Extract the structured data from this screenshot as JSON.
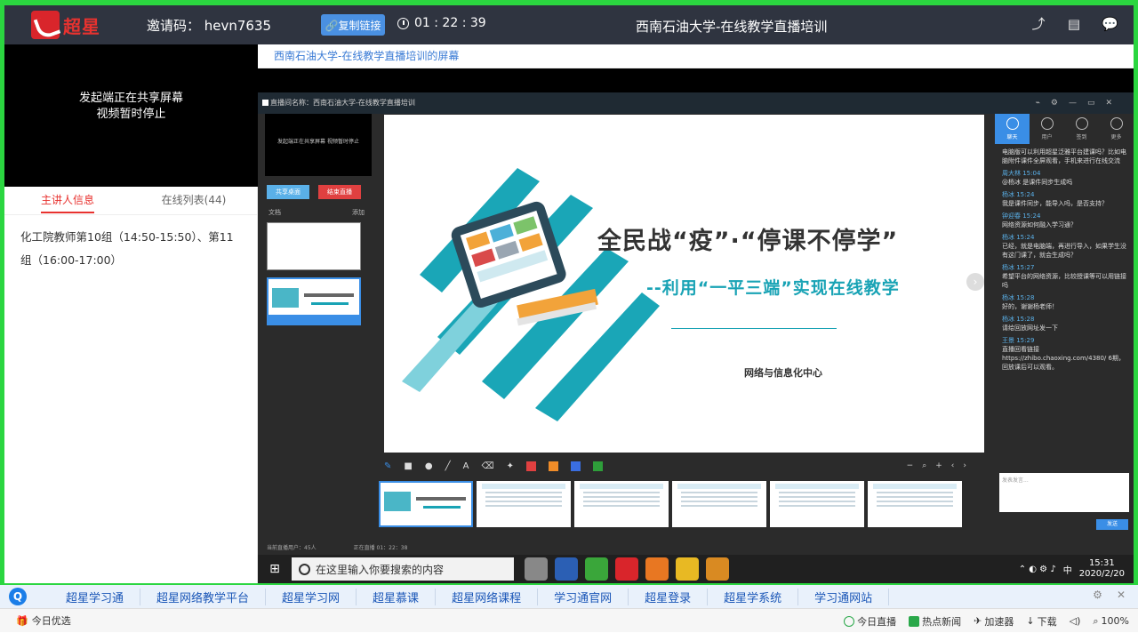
{
  "topbar": {
    "logo_text": "超星",
    "invite": "邀请码： hevn7635",
    "copy_label": "🔗复制链接",
    "timer": "01 : 22 : 39",
    "title": "西南石油大学-在线教学直播培训"
  },
  "left": {
    "video_line1": "发起端正在共享屏幕",
    "video_line2": "视频暂时停止",
    "tab_host": "主讲人信息",
    "tab_online": "在线列表(44)",
    "host_info": "化工院教师第10组（14:50-15:50）、第11组（16:00-17:00）"
  },
  "share": {
    "title": "西南石油大学-在线教学直播培训的屏幕",
    "app_title": "直播间名称：西南石油大学-在线教学直播培训",
    "mini_video": "发起端正在共享屏幕 视频暂时停止",
    "btn_blue": "共享桌面",
    "btn_red": "结束直播",
    "col_doc": "文档",
    "col_add": "添加",
    "slide_title": "全民战“疫”·“停课不停学”",
    "slide_sub": "--利用“一平三端”实现在线教学",
    "slide_org": "网络与信息化中心",
    "status": "当前直播用户：45人",
    "live_time": "正在直播 01：22：38",
    "chat_tabs": [
      "聊天",
      "用户",
      "签到",
      "更多"
    ],
    "chat": [
      {
        "who": "",
        "text": "电脑版可以利用超星泛雅平台建课吗？比如电脑附件课件全屏观看，手机来进行在线交流"
      },
      {
        "who": "周大林 15:04",
        "text": "@杨冰 是课件同步生成吗"
      },
      {
        "who": "杨冰 15:24",
        "text": "我是课件同步，能导入吗，是否支持？"
      },
      {
        "who": "钟迎春 15:24",
        "text": "网络资源如何融入学习通？"
      },
      {
        "who": "杨冰 15:24",
        "text": "已经，就是电脑端，再进行导入，如果学生没有这门课了，就会生成吗？"
      },
      {
        "who": "杨冰 15:27",
        "text": "希望平台的网络资源，比较授课等可以用链接吗"
      },
      {
        "who": "杨冰 15:28",
        "text": "好的，谢谢杨老师！"
      },
      {
        "who": "杨冰 15:28",
        "text": "请给回放网址发一下"
      },
      {
        "who": "王景 15:29",
        "text": "直播回看链接 https://zhibo.chaoxing.com/4380/ 6期，回放课后可以观看。"
      }
    ],
    "chat_placeholder": "发表发言..."
  },
  "taskbar": {
    "search": "在这里输入你要搜索的内容",
    "time": "15:31",
    "date": "2020/2/20",
    "lang": "中"
  },
  "linkbar": {
    "links": [
      "超星学习通",
      "超星网络教学平台",
      "超星学习网",
      "超星慕课",
      "超星网络课程",
      "学习通官网",
      "超星登录",
      "超星学系统",
      "学习通网站"
    ]
  },
  "statusbar": {
    "left": "今日优选",
    "items": [
      "今日直播",
      "热点新闻",
      "加速器",
      "下载",
      "100%"
    ]
  },
  "colors": {
    "accent": "#e8322f",
    "link": "#1a56b7",
    "blue": "#3a8ee6",
    "teal": "#19a3b5"
  }
}
